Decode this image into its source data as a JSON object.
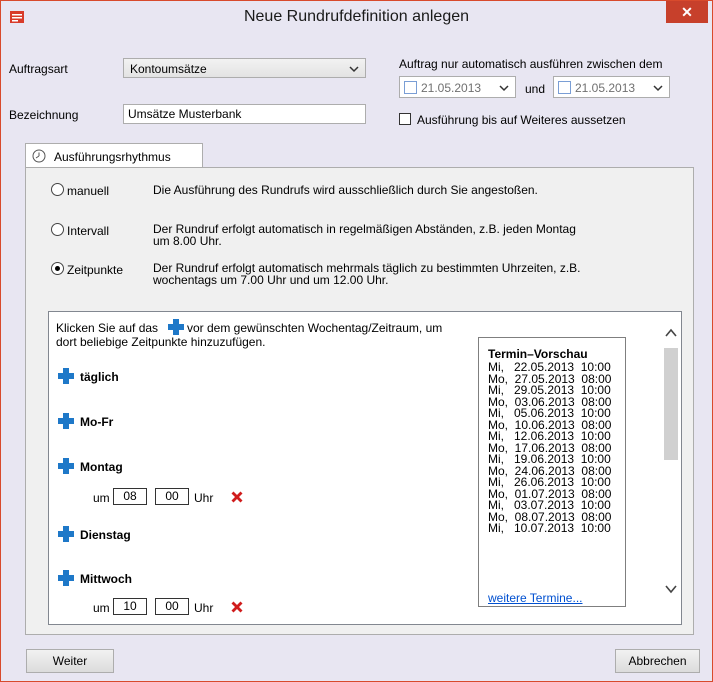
{
  "window": {
    "title": "Neue Rundrufdefinition anlegen",
    "close_glyph": "✕"
  },
  "auftragsart": {
    "label": "Auftragsart",
    "value": "Kontoumsätze"
  },
  "bezeichnung": {
    "label": "Bezeichnung",
    "value": "Umsätze Musterbank"
  },
  "auto": {
    "label": "Auftrag nur automatisch ausführen zwischen dem",
    "date_from": "21.05.2013",
    "und": "und",
    "date_to": "21.05.2013",
    "suspend_label": "Ausführung bis auf Weiteres aussetzen"
  },
  "tab": {
    "label": "Ausführungsrhythmus"
  },
  "rhythm": {
    "options": [
      {
        "label": "manuell",
        "desc1": "Die Ausführung des Rundrufs wird ausschließlich durch Sie angestoßen.",
        "desc2": ""
      },
      {
        "label": "Intervall",
        "desc1": "Der Rundruf erfolgt automatisch in regelmäßigen Abständen, z.B. jeden Montag",
        "desc2": "um 8.00 Uhr."
      },
      {
        "label": "Zeitpunkte",
        "desc1": "Der Rundruf erfolgt automatisch mehrmals täglich zu bestimmten Uhrzeiten, z.B.",
        "desc2": "wochentags um 7.00 Uhr und um 12.00 Uhr."
      }
    ],
    "selected": "Zeitpunkte"
  },
  "schedule": {
    "hint_part1": "Klicken Sie auf das",
    "hint_part2": "vor dem gewünschten Wochentag/Zeitraum, um",
    "hint_line2": "dort beliebige Zeitpunkte hinzuzufügen.",
    "days": [
      "täglich",
      "Mo-Fr",
      "Montag",
      "Dienstag",
      "Mittwoch"
    ],
    "um": "um",
    "uhr": "Uhr",
    "montag_time": {
      "h": "08",
      "m": "00"
    },
    "mittwoch_time": {
      "h": "10",
      "m": "00"
    }
  },
  "preview": {
    "title": "Termin–Vorschau",
    "entries": [
      "Mi,   22.05.2013  10:00",
      "Mo,  27.05.2013  08:00",
      "Mi,   29.05.2013  10:00",
      "Mo,  03.06.2013  08:00",
      "Mi,   05.06.2013  10:00",
      "Mo,  10.06.2013  08:00",
      "Mi,   12.06.2013  10:00",
      "Mo,  17.06.2013  08:00",
      "Mi,   19.06.2013  10:00",
      "Mo,  24.06.2013  08:00",
      "Mi,   26.06.2013  10:00",
      "Mo,  01.07.2013  08:00",
      "Mi,   03.07.2013  10:00",
      "Mo,  08.07.2013  08:00",
      "Mi,   10.07.2013  10:00"
    ],
    "more_link": "weitere Termine..."
  },
  "buttons": {
    "next": "Weiter",
    "cancel": "Abbrechen"
  },
  "colors": {
    "accent_red": "#c7402b",
    "plus_blue": "#1e78c8",
    "delete_red": "#d01c1c",
    "link_blue": "#0050d0"
  }
}
